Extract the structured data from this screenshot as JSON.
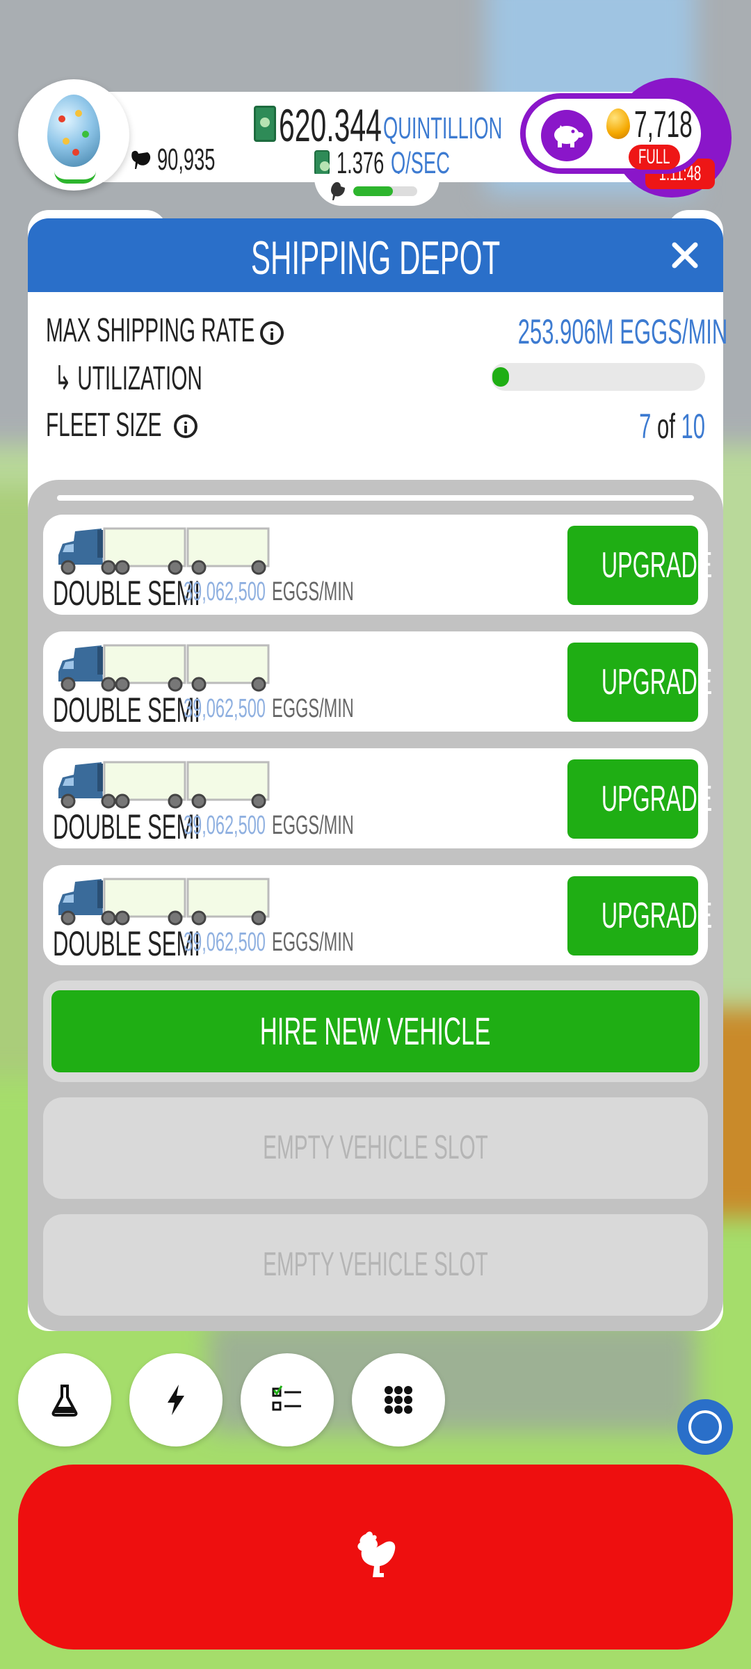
{
  "header": {
    "chicken_count": "90,935",
    "cash_value": "620.344",
    "cash_unit": "QUINTILLION",
    "rate_value": "1.376",
    "rate_unit": "Q/SEC",
    "drone_progress": 0.62,
    "golden_eggs": "7,718",
    "full_label": "FULL",
    "timer": "1:11:48"
  },
  "panel": {
    "title": "SHIPPING DEPOT",
    "max_rate_label": "MAX SHIPPING RATE",
    "max_rate_value": "253.906M EGGS/MIN",
    "utilization_label": "↳ UTILIZATION",
    "utilization_fraction": 0.05,
    "fleet_label": "FLEET SIZE",
    "fleet_current": "7",
    "fleet_of": "of",
    "fleet_max": "10"
  },
  "vehicles": [
    {
      "name": "DOUBLE SEMI",
      "rate": "39,062,500",
      "unit": "EGGS/MIN",
      "button": "UPGRADE"
    },
    {
      "name": "DOUBLE SEMI",
      "rate": "39,062,500",
      "unit": "EGGS/MIN",
      "button": "UPGRADE"
    },
    {
      "name": "DOUBLE SEMI",
      "rate": "39,062,500",
      "unit": "EGGS/MIN",
      "button": "UPGRADE"
    },
    {
      "name": "DOUBLE SEMI",
      "rate": "39,062,500",
      "unit": "EGGS/MIN",
      "button": "UPGRADE"
    }
  ],
  "hire_button": "HIRE NEW VEHICLE",
  "empty_slots": [
    "EMPTY VEHICLE SLOT",
    "EMPTY VEHICLE SLOT"
  ],
  "bottom_icons": [
    "flask-icon",
    "lightning-icon",
    "checklist-icon",
    "grid-icon"
  ],
  "colors": {
    "header_blue": "#2a6fc9",
    "green": "#1fae14",
    "purple": "#8a16c9",
    "red": "#ee0f0f",
    "value_blue": "#3d7bd1"
  }
}
